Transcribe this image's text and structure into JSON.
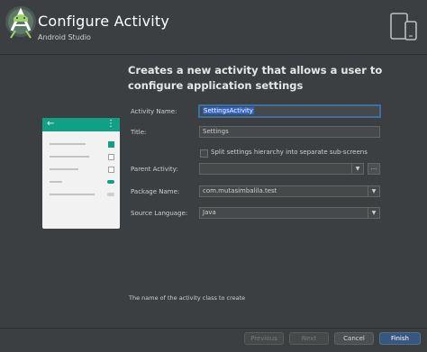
{
  "header": {
    "title": "Configure Activity",
    "subtitle": "Android Studio",
    "logo_icon": "android-studio-logo-icon",
    "device_icon": "phone-tablet-icon"
  },
  "content": {
    "title": "Creates a new activity that allows a user to configure application settings"
  },
  "preview": {
    "back_glyph": "←",
    "menu_glyph": "⋮",
    "accent": "#12a085"
  },
  "form": {
    "activity_name": {
      "label": "Activity Name:",
      "value": "SettingsActivity"
    },
    "title": {
      "label": "Title:",
      "value": "Settings"
    },
    "split_checkbox": {
      "label": "Split settings hierarchy into separate sub-screens",
      "checked": false
    },
    "parent_activity": {
      "label": "Parent Activity:",
      "value": "",
      "browse_label": "..."
    },
    "package_name": {
      "label": "Package Name:",
      "value": "com.mutasimbalila.test"
    },
    "source_language": {
      "label": "Source Language:",
      "value": "Java"
    }
  },
  "hint": "The name of the activity class to create",
  "footer": {
    "previous": "Previous",
    "next": "Next",
    "cancel": "Cancel",
    "finish": "Finish"
  },
  "colors": {
    "background": "#3c3f41",
    "field_bg": "#45494a",
    "primary_button": "#365880",
    "focus_border": "#3d6fa1"
  }
}
